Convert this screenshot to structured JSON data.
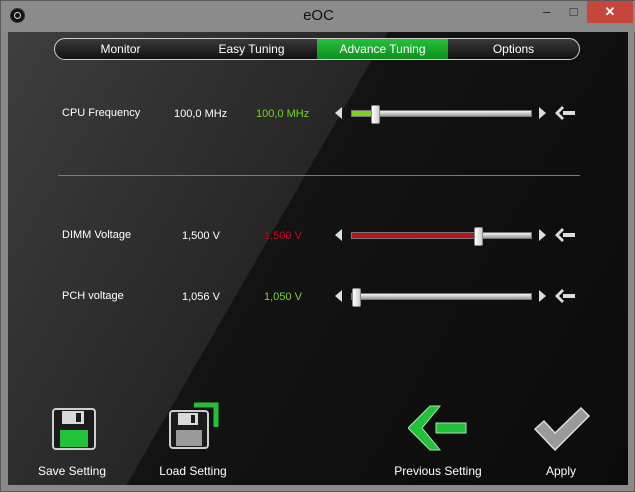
{
  "window": {
    "title": "eOC",
    "minimize": "–",
    "maximize": "□",
    "close": "✕"
  },
  "tabs": [
    {
      "label": "Monitor",
      "active": false
    },
    {
      "label": "Easy Tuning",
      "active": false
    },
    {
      "label": "Advance Tuning",
      "active": true
    },
    {
      "label": "Options",
      "active": false
    }
  ],
  "settings": {
    "cpu": {
      "label": "CPU Frequency",
      "current": "100,0 MHz",
      "target": "100,0 MHz",
      "target_color": "#7ed321",
      "level": 0.11,
      "fill_color": "#7ed321"
    },
    "dimm": {
      "label": "DIMM Voltage",
      "current": "1,500 V",
      "target": "1,500 V",
      "target_color": "#d0021b",
      "level": 0.72,
      "fill_color": "#b3141d"
    },
    "pch": {
      "label": "PCH voltage",
      "current": "1,056 V",
      "target": "1,050 V",
      "target_color": "#7ed321",
      "level": 0.0,
      "fill_color": "#7ed321"
    }
  },
  "actions": {
    "save": "Save Setting",
    "load": "Load Setting",
    "previous": "Previous Setting",
    "apply": "Apply"
  },
  "icons": {
    "save": "floppy-disk-green-icon",
    "load": "floppy-disk-load-icon",
    "previous": "arrow-back-green-icon",
    "apply": "checkmark-icon",
    "reset": "arrow-reset-icon"
  },
  "colors": {
    "accent": "#1fb532"
  }
}
